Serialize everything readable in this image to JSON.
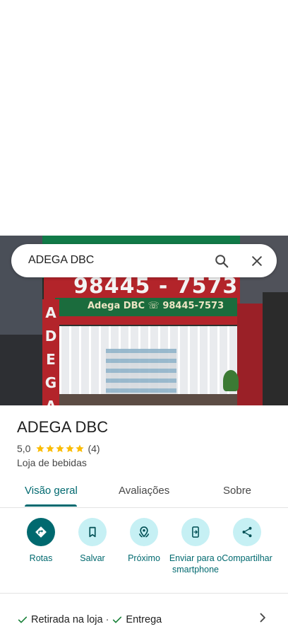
{
  "search": {
    "query": "ADEGA DBC"
  },
  "photo": {
    "sign_phone": "98445 - 7573",
    "sign_band": "Adega DBC ☏ 98445-7573",
    "side_letters": [
      "A",
      "D",
      "E",
      "G",
      "A"
    ]
  },
  "place": {
    "name": "ADEGA DBC",
    "rating": "5,0",
    "stars": 5,
    "review_count": "(4)",
    "category": "Loja de bebidas"
  },
  "tabs": [
    {
      "label": "Visão geral",
      "active": true
    },
    {
      "label": "Avaliações",
      "active": false
    },
    {
      "label": "Sobre",
      "active": false
    }
  ],
  "actions": [
    {
      "label": "Rotas",
      "icon": "directions-icon"
    },
    {
      "label": "Salvar",
      "icon": "bookmark-icon"
    },
    {
      "label": "Próximo",
      "icon": "nearby-icon"
    },
    {
      "label": "Enviar para o smartphone",
      "icon": "send-to-phone-icon"
    },
    {
      "label": "Compartilhar",
      "icon": "share-icon"
    }
  ],
  "services": {
    "item1": "Retirada na loja",
    "separator": "·",
    "item2": "Entrega"
  },
  "colors": {
    "accent": "#00696f",
    "accent_light": "#c6f0f4",
    "star": "#fbbc04",
    "check": "#188038"
  }
}
